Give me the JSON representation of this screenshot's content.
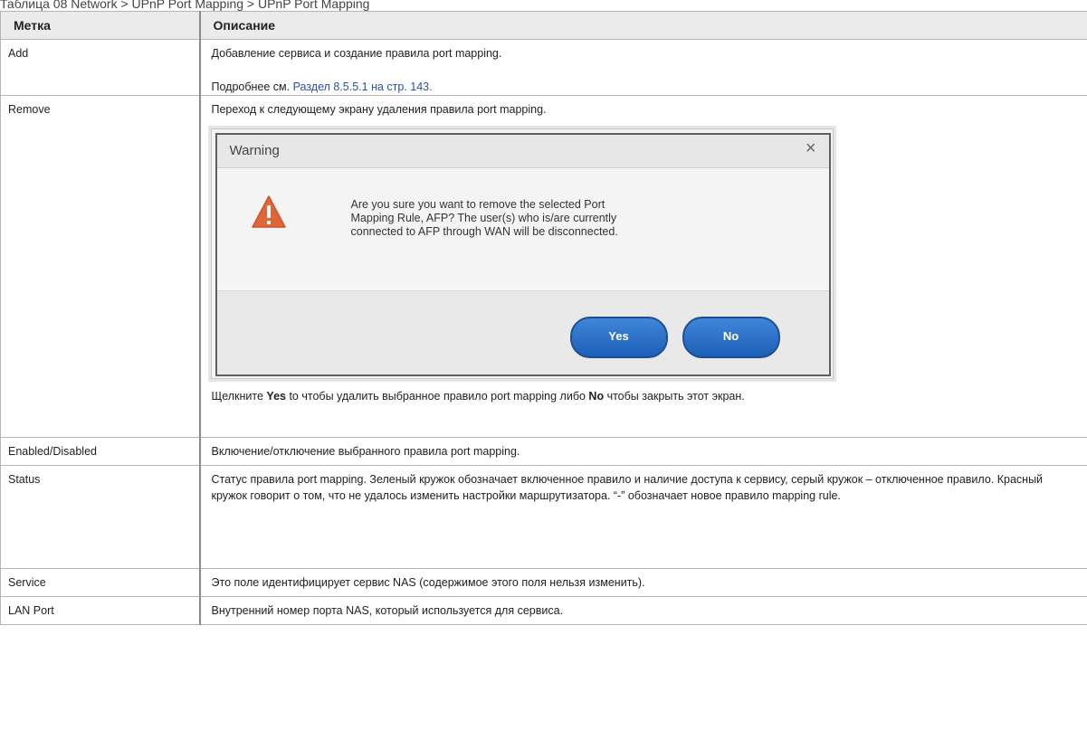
{
  "caption": "Таблица 08 Network > UPnP Port Mapping > UPnP Port Mapping",
  "table": {
    "header": {
      "label": "Метка",
      "description": "Описание"
    },
    "rows": {
      "add": {
        "label": "Add",
        "line1": "Добавление сервиса и создание правила port mapping.",
        "see_prefix": "Подробнее см. ",
        "see_link": "Раздел 8.5.5.1 на стр. 143."
      },
      "remove": {
        "label": "Remove",
        "line1": "Переход к следующему экрану удаления правила port mapping.",
        "after_pre": "Щелкните ",
        "yes_word": "Yes",
        "after_mid": " to чтобы удалить выбранное правило port mapping либо ",
        "no_word": "No",
        "after_post": " чтобы закрыть этот экран."
      },
      "enabled": {
        "label": "Enabled/Disabled",
        "text": "Включение/отключение выбранного правила port mapping."
      },
      "status": {
        "label": "Status",
        "text": "Статус правила port mapping. Зеленый кружок обозначает включенное правило и наличие доступа к сервису, серый кружок – отключенное правило. Красный кружок говорит о том, что не удалось изменить настройки маршрутизатора. “-” обозначает новое правило mapping rule."
      },
      "service": {
        "label": "Service",
        "text": "Это поле идентифицирует сервис NAS (содержимое этого поля нельзя изменить)."
      },
      "lanport": {
        "label": "LAN Port",
        "text": "Внутренний номер порта NAS, который используется для сервиса."
      }
    }
  },
  "dialog": {
    "title": "Warning",
    "close": "×",
    "message": "Are you sure you want to remove the selected Port\nMapping Rule, AFP? The user(s) who is/are currently\nconnected to AFP through WAN will be disconnected.",
    "yes": "Yes",
    "no": "No",
    "warn_color": "#e0663a"
  }
}
